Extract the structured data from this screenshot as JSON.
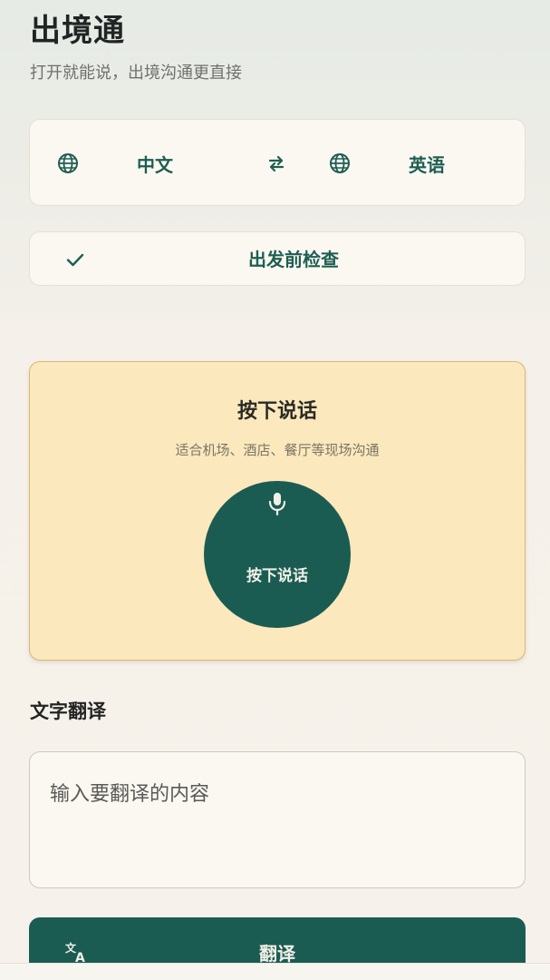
{
  "header": {
    "title": "出境通",
    "subtitle": "打开就能说，出境沟通更直接"
  },
  "language_selector": {
    "source": {
      "label": "中文",
      "icon": "globe-icon"
    },
    "swap": {
      "icon": "swap-icon"
    },
    "target": {
      "label": "英语",
      "icon": "globe-icon"
    }
  },
  "checklist": {
    "label": "出发前检查",
    "icon": "check-icon"
  },
  "voice": {
    "title": "按下说话",
    "hint": "适合机场、酒店、餐厅等现场沟通",
    "button_label": "按下说话",
    "icon": "microphone-icon"
  },
  "text_translation": {
    "section_title": "文字翻译",
    "input_placeholder": "输入要翻译的内容",
    "input_value": "",
    "button_label": "翻译",
    "button_icon": "translate-icon"
  },
  "colors": {
    "primary": "#1a5c52",
    "voice_card_bg": "#fbe8bc",
    "card_bg": "#faf8f1"
  }
}
